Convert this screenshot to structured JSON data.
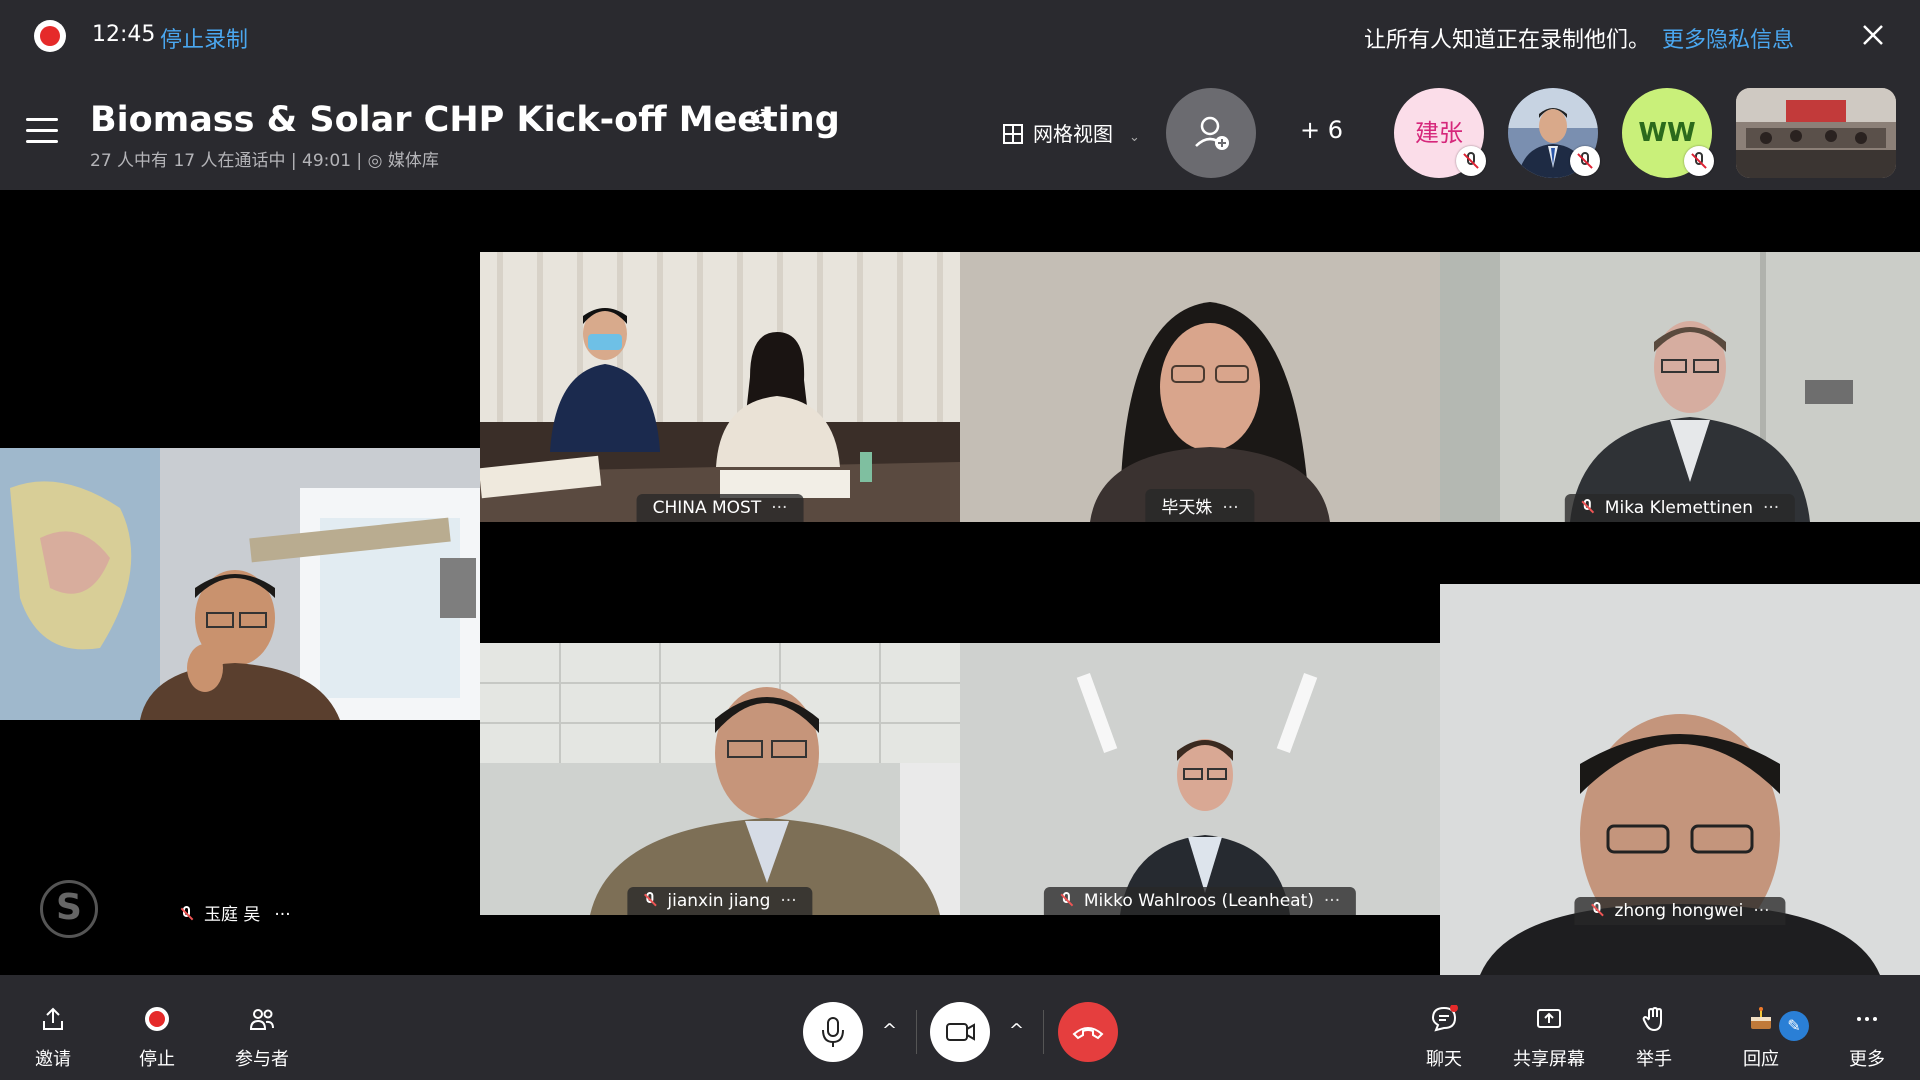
{
  "recording": {
    "time": "12:45",
    "stop_label": "停止录制",
    "notice": "让所有人知道正在录制他们。",
    "privacy_link": "更多隐私信息"
  },
  "meeting": {
    "title": "Biomass & Solar CHP Kick-off Meeting",
    "participants_text": "27 人中有 17 人在通话中",
    "duration": "49:01",
    "media_label": "媒体库"
  },
  "view": {
    "label": "网格视图",
    "overflow_count": "+ 6"
  },
  "top_avatars": [
    {
      "initials": "建张"
    },
    {
      "initials": ""
    },
    {
      "initials": "WW"
    }
  ],
  "tiles": [
    {
      "name": "CHINA MOST",
      "muted": false
    },
    {
      "name": "毕天姝",
      "muted": false
    },
    {
      "name": "Mika Klemettinen",
      "muted": true
    },
    {
      "name": "玉庭 吴",
      "muted": true
    },
    {
      "name": "jianxin jiang",
      "muted": true
    },
    {
      "name": "Mikko Wahlroos (Leanheat)",
      "muted": true
    },
    {
      "name": "zhong hongwei",
      "muted": true
    }
  ],
  "toolbar": {
    "invite": "邀请",
    "stop": "停止",
    "participants": "参与者",
    "chat": "聊天",
    "share": "共享屏幕",
    "raise_hand": "举手",
    "react": "回应",
    "more": "更多"
  },
  "colors": {
    "accent": "#4aa7f0",
    "recording_red": "#e52a2a",
    "end_call": "#e53e3e",
    "bar_bg": "#2a2a2f"
  }
}
